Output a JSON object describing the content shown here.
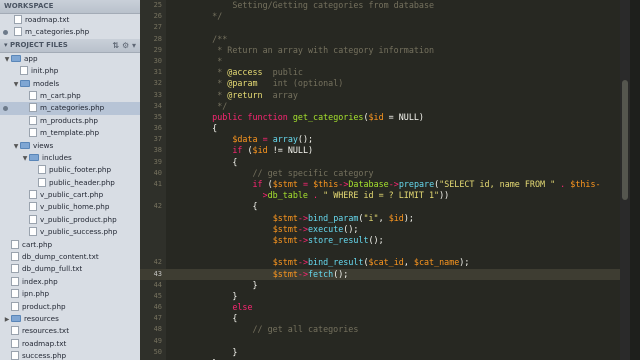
{
  "sidebar": {
    "workspace_header": "WORKSPACE",
    "open_files": [
      "roadmap.txt",
      "m_categories.php"
    ],
    "project_header": "PROJECT FILES",
    "tree": [
      {
        "label": "app",
        "type": "folder",
        "indent": 0,
        "open": true
      },
      {
        "label": "init.php",
        "type": "file",
        "indent": 1
      },
      {
        "label": "models",
        "type": "folder",
        "indent": 1,
        "open": true
      },
      {
        "label": "m_cart.php",
        "type": "file",
        "indent": 2
      },
      {
        "label": "m_categories.php",
        "type": "file",
        "indent": 2,
        "selected": true
      },
      {
        "label": "m_products.php",
        "type": "file",
        "indent": 2
      },
      {
        "label": "m_template.php",
        "type": "file",
        "indent": 2
      },
      {
        "label": "views",
        "type": "folder",
        "indent": 1,
        "open": true
      },
      {
        "label": "includes",
        "type": "folder",
        "indent": 2,
        "open": true
      },
      {
        "label": "public_footer.php",
        "type": "file",
        "indent": 3
      },
      {
        "label": "public_header.php",
        "type": "file",
        "indent": 3
      },
      {
        "label": "v_public_cart.php",
        "type": "file",
        "indent": 2
      },
      {
        "label": "v_public_home.php",
        "type": "file",
        "indent": 2
      },
      {
        "label": "v_public_product.php",
        "type": "file",
        "indent": 2
      },
      {
        "label": "v_public_success.php",
        "type": "file",
        "indent": 2
      },
      {
        "label": "cart.php",
        "type": "file",
        "indent": 0
      },
      {
        "label": "db_dump_content.txt",
        "type": "file",
        "indent": 0
      },
      {
        "label": "db_dump_full.txt",
        "type": "file",
        "indent": 0
      },
      {
        "label": "index.php",
        "type": "file",
        "indent": 0
      },
      {
        "label": "ipn.php",
        "type": "file",
        "indent": 0
      },
      {
        "label": "product.php",
        "type": "file",
        "indent": 0
      },
      {
        "label": "resources",
        "type": "folder",
        "indent": 0,
        "open": false
      },
      {
        "label": "resources.txt",
        "type": "file",
        "indent": 0
      },
      {
        "label": "roadmap.txt",
        "type": "file",
        "indent": 0
      },
      {
        "label": "success.php",
        "type": "file",
        "indent": 0
      }
    ]
  },
  "editor": {
    "active_line": 43,
    "lines": [
      {
        "n": 25,
        "tokens": [
          {
            "t": "        Setting/Getting categories from database",
            "c": "cm"
          }
        ]
      },
      {
        "n": 26,
        "tokens": [
          {
            "t": "    */",
            "c": "cm"
          }
        ]
      },
      {
        "n": 27,
        "tokens": []
      },
      {
        "n": 28,
        "tokens": [
          {
            "t": "    /**",
            "c": "cm"
          }
        ]
      },
      {
        "n": 29,
        "tokens": [
          {
            "t": "     * Return an array with category information",
            "c": "cm"
          }
        ]
      },
      {
        "n": 30,
        "tokens": [
          {
            "t": "     *",
            "c": "cm"
          }
        ]
      },
      {
        "n": 31,
        "tokens": [
          {
            "t": "     * ",
            "c": "cm"
          },
          {
            "t": "@access",
            "c": "tag"
          },
          {
            "t": "  public",
            "c": "cm"
          }
        ]
      },
      {
        "n": 32,
        "tokens": [
          {
            "t": "     * ",
            "c": "cm"
          },
          {
            "t": "@param",
            "c": "tag"
          },
          {
            "t": "   int (optional)",
            "c": "cm"
          }
        ]
      },
      {
        "n": 33,
        "tokens": [
          {
            "t": "     * ",
            "c": "cm"
          },
          {
            "t": "@return",
            "c": "tag"
          },
          {
            "t": "  array",
            "c": "cm"
          }
        ]
      },
      {
        "n": 34,
        "tokens": [
          {
            "t": "     */",
            "c": "cm"
          }
        ]
      },
      {
        "n": 35,
        "tokens": [
          {
            "t": "    ",
            "c": ""
          },
          {
            "t": "public function ",
            "c": "kw"
          },
          {
            "t": "get_categories",
            "c": "fn"
          },
          {
            "t": "(",
            "c": ""
          },
          {
            "t": "$id",
            "c": "var"
          },
          {
            "t": " = NULL)",
            "c": ""
          }
        ]
      },
      {
        "n": 36,
        "tokens": [
          {
            "t": "    {",
            "c": ""
          }
        ]
      },
      {
        "n": 37,
        "tokens": [
          {
            "t": "        ",
            "c": ""
          },
          {
            "t": "$data",
            "c": "var"
          },
          {
            "t": " = ",
            "c": "kw"
          },
          {
            "t": "array",
            "c": "vr"
          },
          {
            "t": "();",
            "c": ""
          }
        ]
      },
      {
        "n": 38,
        "tokens": [
          {
            "t": "        ",
            "c": ""
          },
          {
            "t": "if",
            "c": "kw"
          },
          {
            "t": " (",
            "c": ""
          },
          {
            "t": "$id",
            "c": "var"
          },
          {
            "t": " != NULL)",
            "c": ""
          }
        ]
      },
      {
        "n": 39,
        "tokens": [
          {
            "t": "        {",
            "c": ""
          }
        ]
      },
      {
        "n": 40,
        "tokens": [
          {
            "t": "            // get specific category",
            "c": "cm"
          }
        ]
      },
      {
        "n": 41,
        "tokens": [
          {
            "t": "            ",
            "c": ""
          },
          {
            "t": "if",
            "c": "kw"
          },
          {
            "t": " (",
            "c": ""
          },
          {
            "t": "$stmt",
            "c": "var"
          },
          {
            "t": " = ",
            "c": "kw"
          },
          {
            "t": "$this",
            "c": "var"
          },
          {
            "t": "->",
            "c": "kw"
          },
          {
            "t": "Database",
            "c": "fn"
          },
          {
            "t": "->",
            "c": "kw"
          },
          {
            "t": "prepare",
            "c": "vr"
          },
          {
            "t": "(",
            "c": ""
          },
          {
            "t": "\"SELECT id, name FROM \"",
            "c": "str"
          },
          {
            "t": " . ",
            "c": "kw"
          },
          {
            "t": "$this-",
            "c": "var"
          }
        ]
      },
      {
        "n": null,
        "tokens": [
          {
            "t": "              >",
            "c": "kw"
          },
          {
            "t": "db_table",
            "c": "fn"
          },
          {
            "t": " . ",
            "c": "kw"
          },
          {
            "t": "\" WHERE id = ? LIMIT 1\"",
            "c": "str"
          },
          {
            "t": "))",
            "c": ""
          }
        ]
      },
      {
        "n": 42,
        "tokens": [
          {
            "t": "            {",
            "c": ""
          }
        ]
      },
      {
        "n": null,
        "tokens": [
          {
            "t": "                ",
            "c": ""
          },
          {
            "t": "$stmt",
            "c": "var"
          },
          {
            "t": "->",
            "c": "kw"
          },
          {
            "t": "bind_param",
            "c": "vr"
          },
          {
            "t": "(",
            "c": ""
          },
          {
            "t": "\"i\"",
            "c": "str"
          },
          {
            "t": ", ",
            "c": ""
          },
          {
            "t": "$id",
            "c": "var"
          },
          {
            "t": ");",
            "c": ""
          }
        ]
      },
      {
        "n": null,
        "tokens": [
          {
            "t": "                ",
            "c": ""
          },
          {
            "t": "$stmt",
            "c": "var"
          },
          {
            "t": "->",
            "c": "kw"
          },
          {
            "t": "execute",
            "c": "vr"
          },
          {
            "t": "();",
            "c": ""
          }
        ]
      },
      {
        "n": null,
        "tokens": [
          {
            "t": "                ",
            "c": ""
          },
          {
            "t": "$stmt",
            "c": "var"
          },
          {
            "t": "->",
            "c": "kw"
          },
          {
            "t": "store_result",
            "c": "vr"
          },
          {
            "t": "();",
            "c": ""
          }
        ]
      },
      {
        "n": null,
        "tokens": []
      },
      {
        "n": 42,
        "tokens": [
          {
            "t": "                ",
            "c": ""
          },
          {
            "t": "$stmt",
            "c": "var"
          },
          {
            "t": "->",
            "c": "kw"
          },
          {
            "t": "bind_result",
            "c": "vr"
          },
          {
            "t": "(",
            "c": ""
          },
          {
            "t": "$cat_id",
            "c": "var"
          },
          {
            "t": ", ",
            "c": ""
          },
          {
            "t": "$cat_name",
            "c": "var"
          },
          {
            "t": ");",
            "c": ""
          }
        ]
      },
      {
        "n": 43,
        "tokens": [
          {
            "t": "                ",
            "c": ""
          },
          {
            "t": "$stmt",
            "c": "var"
          },
          {
            "t": "->",
            "c": "kw"
          },
          {
            "t": "fetch",
            "c": "vr"
          },
          {
            "t": "();",
            "c": ""
          }
        ]
      },
      {
        "n": 44,
        "tokens": [
          {
            "t": "            }",
            "c": ""
          }
        ]
      },
      {
        "n": 45,
        "tokens": [
          {
            "t": "        }",
            "c": ""
          }
        ]
      },
      {
        "n": 46,
        "tokens": [
          {
            "t": "        ",
            "c": ""
          },
          {
            "t": "else",
            "c": "kw"
          }
        ]
      },
      {
        "n": 47,
        "tokens": [
          {
            "t": "        {",
            "c": ""
          }
        ]
      },
      {
        "n": 48,
        "tokens": [
          {
            "t": "            // get all categories",
            "c": "cm"
          }
        ]
      },
      {
        "n": 49,
        "tokens": []
      },
      {
        "n": 50,
        "tokens": [
          {
            "t": "        }",
            "c": ""
          }
        ]
      },
      {
        "n": 51,
        "tokens": [
          {
            "t": "    }",
            "c": ""
          }
        ]
      }
    ]
  },
  "colors": {
    "editor_bg": "#272822",
    "comment": "#75715e",
    "keyword": "#f92672",
    "function": "#a6e22e",
    "variable": "#fd971f",
    "builtin": "#66d9ef",
    "string": "#e6db74"
  }
}
